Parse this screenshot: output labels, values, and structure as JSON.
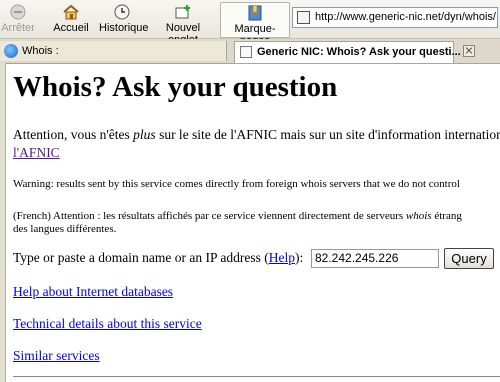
{
  "toolbar": {
    "back_label": "Arrêter",
    "home_label": "Accueil",
    "history_label": "Historique",
    "new_tab_label": "Nouvel onglet",
    "bookmarks_label": "Marque-pages",
    "url": "http://www.generic-nic.net/dyn/whois/"
  },
  "tabs": {
    "sidebar_label": "Whois :",
    "page_label": "Generic NIC: Whois? Ask your questi..."
  },
  "page": {
    "title": "Whois? Ask your question",
    "attention_before": "Attention, vous n'êtes ",
    "attention_em": "plus",
    "attention_after": " sur le site de l'AFNIC mais sur un site d'information internationa",
    "afnic_link": "l'AFNIC",
    "warning": "Warning: results sent by this service comes directly from foreign whois servers that we do not control",
    "french_line1_before": "(French) Attention : les résultats affichés par ce service viennent directement de serveurs ",
    "french_line1_em": "whois",
    "french_line1_after": " étrang",
    "french_line2": "des langues différentes.",
    "prompt_before": "Type or paste a domain name or an IP address (",
    "help_link": "Help",
    "prompt_after": "):",
    "query_value": "82.242.245.226",
    "query_button": "Query",
    "links": [
      "Help about Internet databases",
      "Technical details about this service",
      "Similar services"
    ]
  }
}
